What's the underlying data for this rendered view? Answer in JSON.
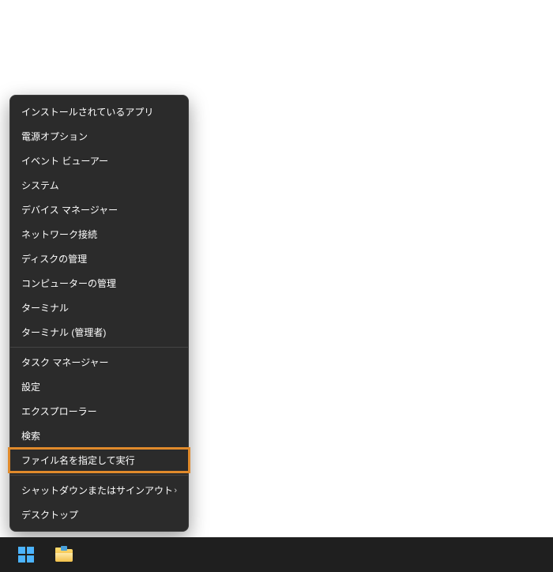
{
  "menu": {
    "groups": [
      [
        {
          "label": "インストールされているアプリ"
        },
        {
          "label": "電源オプション"
        },
        {
          "label": "イベント ビューアー"
        },
        {
          "label": "システム"
        },
        {
          "label": "デバイス マネージャー"
        },
        {
          "label": "ネットワーク接続"
        },
        {
          "label": "ディスクの管理"
        },
        {
          "label": "コンピューターの管理"
        },
        {
          "label": "ターミナル"
        },
        {
          "label": "ターミナル (管理者)"
        }
      ],
      [
        {
          "label": "タスク マネージャー"
        },
        {
          "label": "設定"
        },
        {
          "label": "エクスプローラー"
        },
        {
          "label": "検索"
        },
        {
          "label": "ファイル名を指定して実行",
          "highlighted": true
        }
      ],
      [
        {
          "label": "シャットダウンまたはサインアウト",
          "submenu": true
        },
        {
          "label": "デスクトップ"
        }
      ]
    ]
  },
  "taskbar": {
    "items": [
      "start",
      "file-explorer"
    ]
  },
  "highlight_color": "#e08a2b"
}
